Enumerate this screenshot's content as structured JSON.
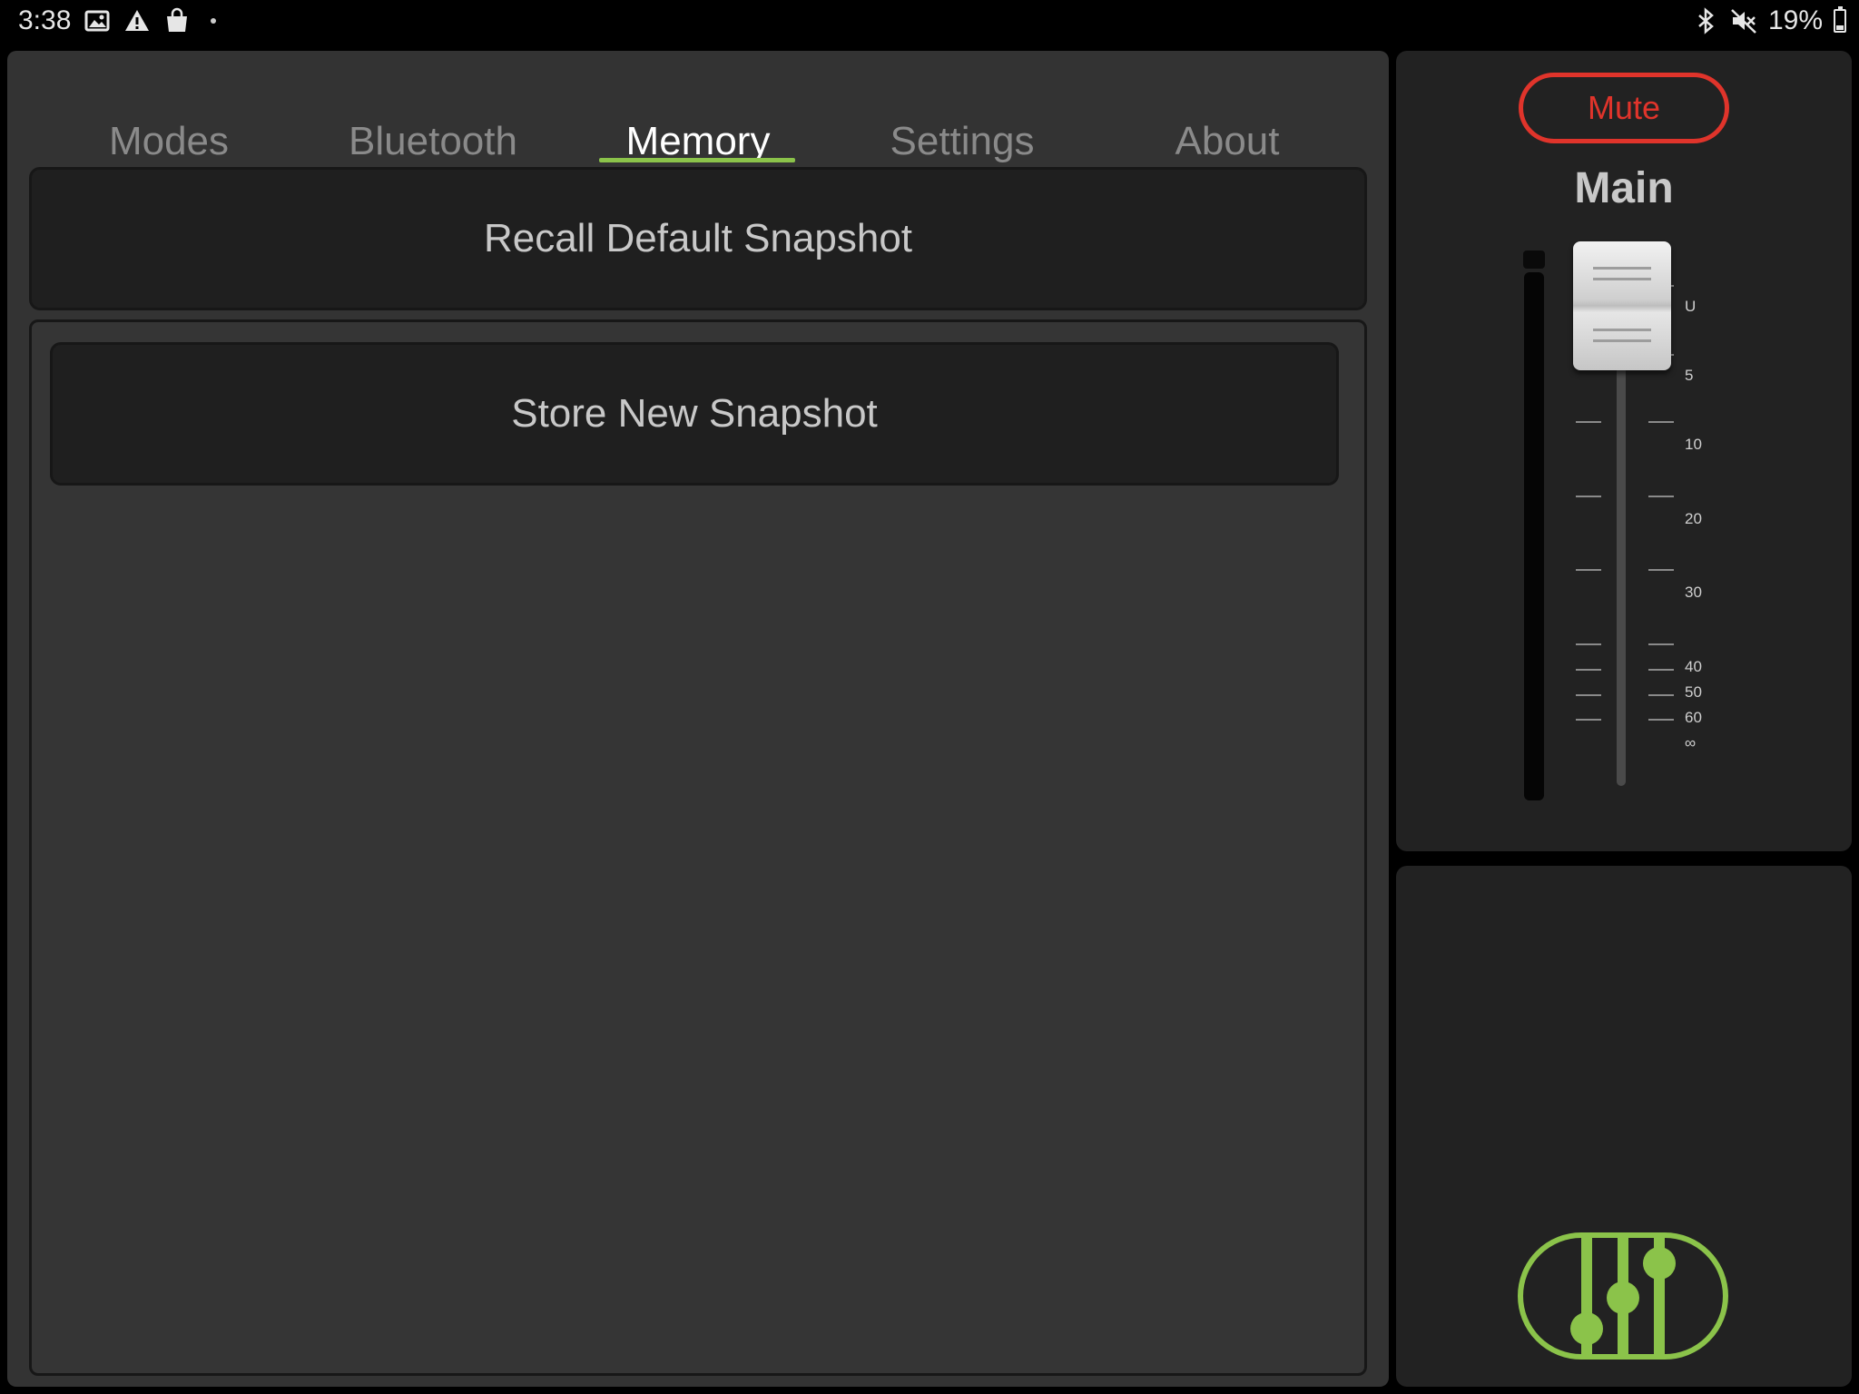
{
  "status_bar": {
    "time": "3:38",
    "left_icons": [
      "image-icon",
      "warning-icon",
      "shopping-bag-icon",
      "dot-icon"
    ],
    "right_icons": [
      "bluetooth-icon",
      "mute-volume-icon",
      "battery-icon"
    ],
    "battery": "19%"
  },
  "tabs": [
    {
      "label": "Modes",
      "active": false
    },
    {
      "label": "Bluetooth",
      "active": false
    },
    {
      "label": "Memory",
      "active": true
    },
    {
      "label": "Settings",
      "active": false
    },
    {
      "label": "About",
      "active": false
    }
  ],
  "memory": {
    "recall_label": "Recall Default Snapshot",
    "store_label": "Store New Snapshot"
  },
  "channel": {
    "mute_label": "Mute",
    "name": "Main",
    "fader_scale": [
      "U",
      "5",
      "10",
      "20",
      "30",
      "40",
      "50",
      "60",
      "∞"
    ]
  },
  "colors": {
    "accent": "#8bc34a",
    "mute": "#e0342b",
    "panel": "#333333",
    "side_panel": "#222222"
  }
}
